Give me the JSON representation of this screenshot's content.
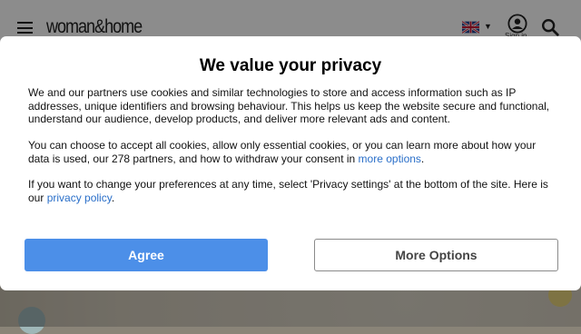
{
  "header": {
    "logo_text": "woman&home",
    "signin_label": "Sign in"
  },
  "privacy_modal": {
    "title": "We value your privacy",
    "p1": "We and our partners use cookies and similar technologies to store and access information such as IP addresses, unique identifiers and browsing behaviour. This helps us keep the website secure and functional, understand our audience, develop products, and deliver more relevant ads and content.",
    "p2_before": "You can choose to accept all cookies, allow only essential cookies, or you can learn more about how your data is used, our 278 partners, and how to withdraw your consent in ",
    "p2_link": "more options",
    "p2_after": ".",
    "p3_before": "If you want to change your preferences at any time, select 'Privacy settings' at the bottom of the site. Here is our ",
    "p3_link": "privacy policy",
    "p3_after": ".",
    "agree_label": "Agree",
    "more_options_label": "More Options"
  },
  "colors": {
    "agree_bg": "#4c8fe8",
    "link": "#2a6fc9"
  }
}
